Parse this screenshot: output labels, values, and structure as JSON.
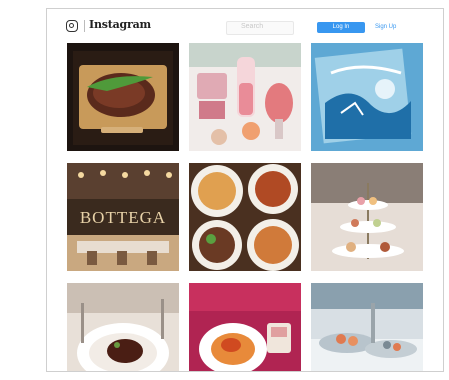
{
  "header": {
    "logo_icon": "camera-glyph-icon",
    "wordmark": "Instagram",
    "search_placeholder": "Search",
    "login_button": "Log In",
    "signup_link": "Sign Up"
  },
  "colors": {
    "accent": "#3897f0",
    "border": "#cfcfcf"
  },
  "tiles": [
    {
      "subject": "steak-on-board-with-greens"
    },
    {
      "subject": "pink-cocktails-and-dessert"
    },
    {
      "subject": "blue-ocean-illustrated-menu"
    },
    {
      "subject": "bottega-restaurant-interior",
      "sign_text": "BOTTEGA"
    },
    {
      "subject": "four-plated-dishes-overhead"
    },
    {
      "subject": "afternoon-tea-tiered-stand"
    },
    {
      "subject": "plated-meat-fine-dining"
    },
    {
      "subject": "pasta-plate-on-magenta-table"
    },
    {
      "subject": "seafood-buffet-display"
    }
  ]
}
